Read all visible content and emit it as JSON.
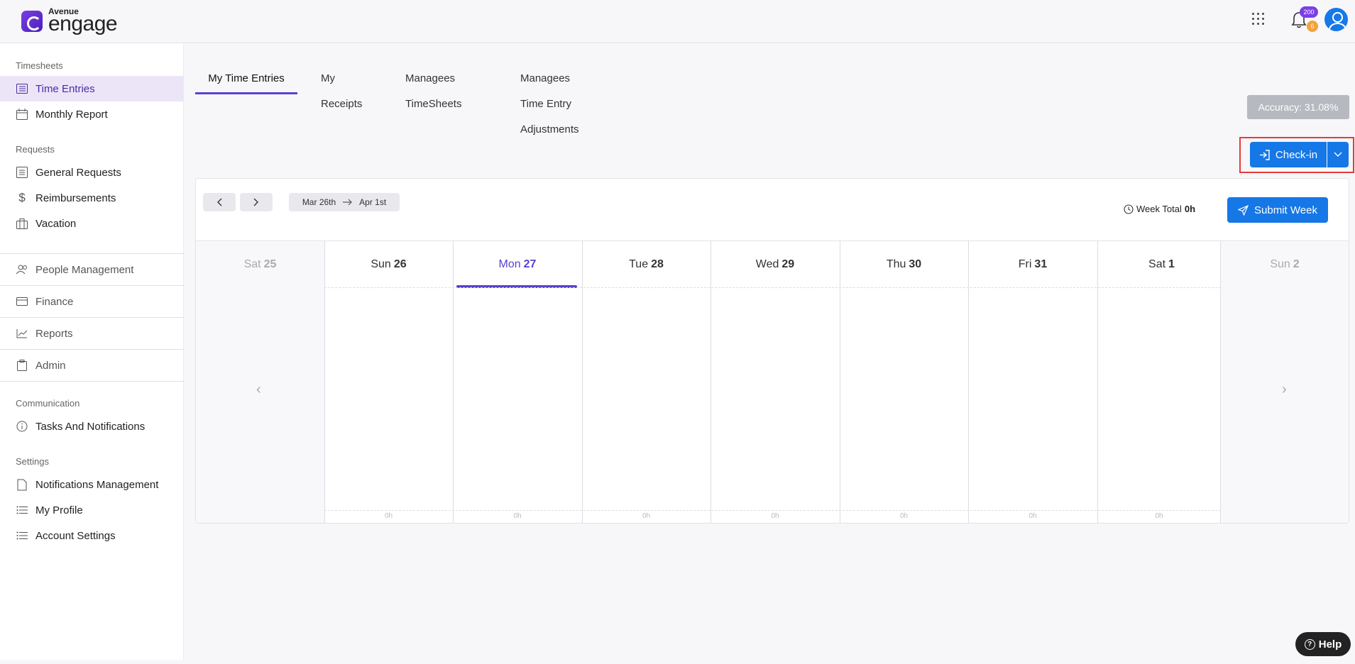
{
  "brand": {
    "small": "Avenue",
    "big": "engage"
  },
  "header": {
    "notifications_count": "200",
    "alerts_count": "6"
  },
  "sidebar": {
    "sections": {
      "timesheets": "Timesheets",
      "requests": "Requests",
      "communication": "Communication",
      "settings": "Settings"
    },
    "items": {
      "time_entries": "Time Entries",
      "monthly_report": "Monthly Report",
      "general_requests": "General Requests",
      "reimbursements": "Reimbursements",
      "vacation": "Vacation",
      "people_management": "People Management",
      "finance": "Finance",
      "reports": "Reports",
      "admin": "Admin",
      "tasks_notifications": "Tasks And Notifications",
      "notifications_management": "Notifications Management",
      "my_profile": "My Profile",
      "account_settings": "Account Settings"
    }
  },
  "tabs": {
    "my_time_entries": "My Time Entries",
    "my_receipts": "My Receipts",
    "managees_timesheets": "Managees TimeSheets",
    "managees_adjustments": "Managees Time Entry Adjustments"
  },
  "accuracy": "Accuracy: 31.08%",
  "checkin": "Check-in",
  "calendar": {
    "range_start": "Mar 26th",
    "range_end": "Apr 1st",
    "week_total_label": "Week Total",
    "week_total_value": "0h",
    "submit": "Submit Week",
    "days": [
      {
        "name": "Sat",
        "num": "25"
      },
      {
        "name": "Sun",
        "num": "26"
      },
      {
        "name": "Mon",
        "num": "27"
      },
      {
        "name": "Tue",
        "num": "28"
      },
      {
        "name": "Wed",
        "num": "29"
      },
      {
        "name": "Thu",
        "num": "30"
      },
      {
        "name": "Fri",
        "num": "31"
      },
      {
        "name": "Sat",
        "num": "1"
      },
      {
        "name": "Sun",
        "num": "2"
      }
    ],
    "day_totals": [
      "0h",
      "0h",
      "0h",
      "0h",
      "0h",
      "0h",
      "0h"
    ]
  },
  "help": "Help",
  "colors": {
    "primary": "#1677e6",
    "accent": "#5b3fd0",
    "active_bg": "#ece5f8"
  }
}
